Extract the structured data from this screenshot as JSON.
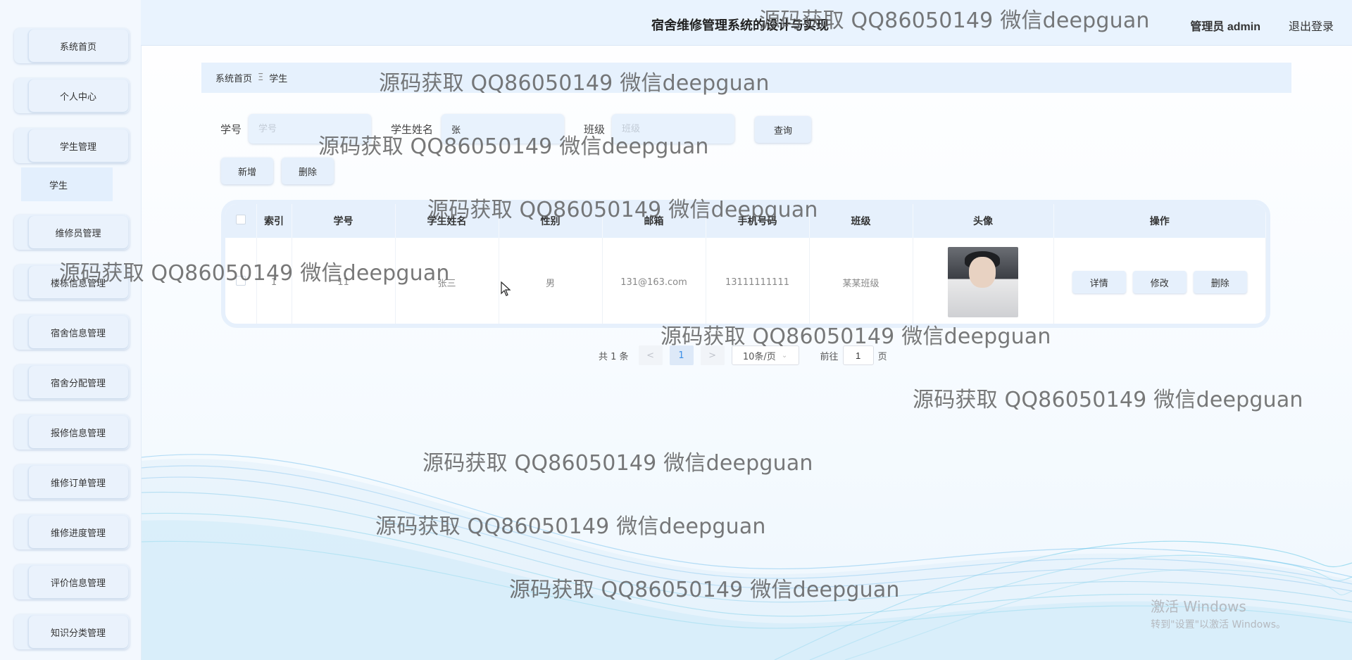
{
  "header": {
    "title": "宿舍维修管理系统的设计与实现",
    "user": "管理员 admin",
    "logout": "退出登录"
  },
  "sidebar": {
    "items": [
      {
        "label": "系统首页"
      },
      {
        "label": "个人中心"
      },
      {
        "label": "学生管理"
      },
      {
        "label": "维修员管理"
      },
      {
        "label": "楼栋信息管理"
      },
      {
        "label": "宿舍信息管理"
      },
      {
        "label": "宿舍分配管理"
      },
      {
        "label": "报修信息管理"
      },
      {
        "label": "维修订单管理"
      },
      {
        "label": "维修进度管理"
      },
      {
        "label": "评价信息管理"
      },
      {
        "label": "知识分类管理"
      }
    ],
    "submenu_label": "学生"
  },
  "breadcrumb": {
    "home": "系统首页",
    "separator": "Ξ",
    "current": "学生"
  },
  "search": {
    "student_no_label": "学号",
    "student_no_placeholder": "学号",
    "name_label": "学生姓名",
    "name_value": "张",
    "class_label": "班级",
    "class_placeholder": "班级",
    "query_button": "查询"
  },
  "actions": {
    "add": "新增",
    "delete": "删除"
  },
  "table": {
    "headers": [
      "索引",
      "学号",
      "学生姓名",
      "性别",
      "邮箱",
      "手机号码",
      "班级",
      "头像",
      "操作"
    ],
    "rows": [
      {
        "index": "1",
        "student_no": "11",
        "name": "张三",
        "gender": "男",
        "email": "131@163.com",
        "phone": "13111111111",
        "class": "某某班级",
        "buttons": {
          "detail": "详情",
          "edit": "修改",
          "delete": "删除"
        }
      }
    ]
  },
  "pagination": {
    "total": "共 1 条",
    "prev": "<",
    "current_page": "1",
    "next": ">",
    "page_size": "10条/页",
    "goto_label": "前往",
    "goto_value": "1",
    "page_unit": "页"
  },
  "watermark": {
    "text": "源码获取 QQ86050149 微信deepguan"
  },
  "windows_activation": {
    "line1": "激活 Windows",
    "line2": "转到\"设置\"以激活 Windows。"
  },
  "colors": {
    "accent": "#e6f0fc",
    "header_bg": "#e9f3fe",
    "link_blue": "#3a8ee6"
  }
}
